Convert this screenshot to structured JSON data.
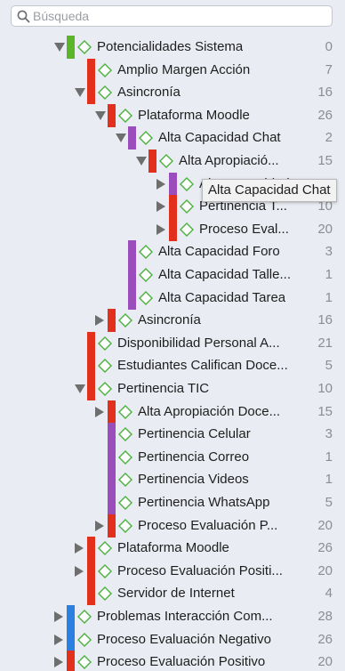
{
  "search": {
    "placeholder": "Búsqueda"
  },
  "colors": {
    "green": "#5bb52a",
    "red": "#e3301d",
    "purple": "#9b4dbb",
    "blue": "#2b7fe0",
    "diamond": "#49b13c"
  },
  "tooltip": {
    "text": "Alta Capacidad Chat"
  },
  "tree": {
    "rows": [
      {
        "label": "Potencialidades Sistema",
        "count": "0",
        "toggle": "open",
        "color": "green"
      },
      {
        "label": "Amplio Margen Acción",
        "count": "7",
        "toggle": "none",
        "color": "red"
      },
      {
        "label": "Asincronía",
        "count": "16",
        "toggle": "open",
        "color": "red"
      },
      {
        "label": "Plataforma Moodle",
        "count": "26",
        "toggle": "open",
        "color": "red"
      },
      {
        "label": "Alta Capacidad Chat",
        "count": "2",
        "toggle": "open",
        "color": "purple"
      },
      {
        "label": "Alta Apropiació...",
        "count": "15",
        "toggle": "open",
        "color": "red"
      },
      {
        "label": "Alta Capacidad Chat",
        "count": "",
        "toggle": "closed",
        "color": "purple"
      },
      {
        "label": "Pertinencia T...",
        "count": "10",
        "toggle": "closed",
        "color": "red"
      },
      {
        "label": "Proceso Eval...",
        "count": "20",
        "toggle": "closed",
        "color": "red"
      },
      {
        "label": "Alta Capacidad Foro",
        "count": "3",
        "toggle": "none",
        "color": "purple"
      },
      {
        "label": "Alta Capacidad Talle...",
        "count": "1",
        "toggle": "none",
        "color": "purple"
      },
      {
        "label": "Alta Capacidad Tarea",
        "count": "1",
        "toggle": "none",
        "color": "purple"
      },
      {
        "label": "Asincronía",
        "count": "16",
        "toggle": "closed",
        "color": "red"
      },
      {
        "label": "Disponibilidad Personal A...",
        "count": "21",
        "toggle": "none",
        "color": "red"
      },
      {
        "label": "Estudiantes Califican Doce...",
        "count": "5",
        "toggle": "none",
        "color": "red"
      },
      {
        "label": "Pertinencia TIC",
        "count": "10",
        "toggle": "open",
        "color": "red"
      },
      {
        "label": "Alta Apropiación Doce...",
        "count": "15",
        "toggle": "closed",
        "color": "red"
      },
      {
        "label": "Pertinencia Celular",
        "count": "3",
        "toggle": "none",
        "color": "purple"
      },
      {
        "label": "Pertinencia Correo",
        "count": "1",
        "toggle": "none",
        "color": "purple"
      },
      {
        "label": "Pertinencia Videos",
        "count": "1",
        "toggle": "none",
        "color": "purple"
      },
      {
        "label": "Pertinencia WhatsApp",
        "count": "5",
        "toggle": "none",
        "color": "purple"
      },
      {
        "label": "Proceso Evaluación P...",
        "count": "20",
        "toggle": "closed",
        "color": "red"
      },
      {
        "label": "Plataforma Moodle",
        "count": "26",
        "toggle": "closed",
        "color": "red"
      },
      {
        "label": "Proceso Evaluación Positi...",
        "count": "20",
        "toggle": "closed",
        "color": "red"
      },
      {
        "label": "Servidor de Internet",
        "count": "4",
        "toggle": "none",
        "color": "red"
      },
      {
        "label": "Problemas Interacción Com...",
        "count": "28",
        "toggle": "closed",
        "color": "blue"
      },
      {
        "label": "Proceso Evaluación Negativo",
        "count": "26",
        "toggle": "closed",
        "color": "blue"
      },
      {
        "label": "Proceso Evaluación Positivo",
        "count": "20",
        "toggle": "closed",
        "color": "red"
      }
    ]
  }
}
